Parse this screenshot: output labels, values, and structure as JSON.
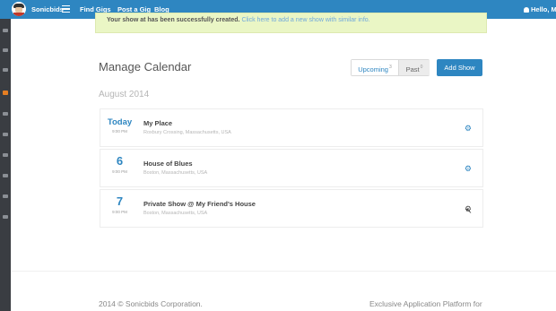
{
  "nav": {
    "brand": "Sonicbids",
    "items": [
      "Find Gigs",
      "Post a Gig",
      "Blog"
    ],
    "user": "Hello, Mi"
  },
  "alert": {
    "message": "Your show at has been successfully created.",
    "link": "Click here to add a new show with similar info."
  },
  "calendar": {
    "title": "Manage Calendar",
    "tabs": [
      {
        "label": "Upcoming",
        "count": "3"
      },
      {
        "label": "Past",
        "count": "0"
      }
    ],
    "add_button": "Add Show",
    "month": "August 2014",
    "shows": [
      {
        "day": "Today",
        "time": "9:00 PM",
        "name": "My Place",
        "location": "Roxbury Crossing, Massachusetts, USA"
      },
      {
        "day": "6",
        "time": "9:00 PM",
        "name": "House of Blues",
        "location": "Boston, Massachusetts, USA"
      },
      {
        "day": "7",
        "time": "9:00 PM",
        "name": "Private Show @ My Friend's House",
        "location": "Boston, Massachusetts, USA"
      }
    ]
  },
  "footer": {
    "copyright": "2014 © Sonicbids Corporation.",
    "tagline": "Exclusive Application Platform for"
  },
  "icons": {
    "gear": "gear-icon",
    "menu": "hamburger-menu-icon",
    "user": "user-icon"
  },
  "colors": {
    "primary": "#2e86c1",
    "alert_bg": "#eaf6c5",
    "sidebar": "#3a3d42",
    "sidebar_active": "#e67e22"
  }
}
